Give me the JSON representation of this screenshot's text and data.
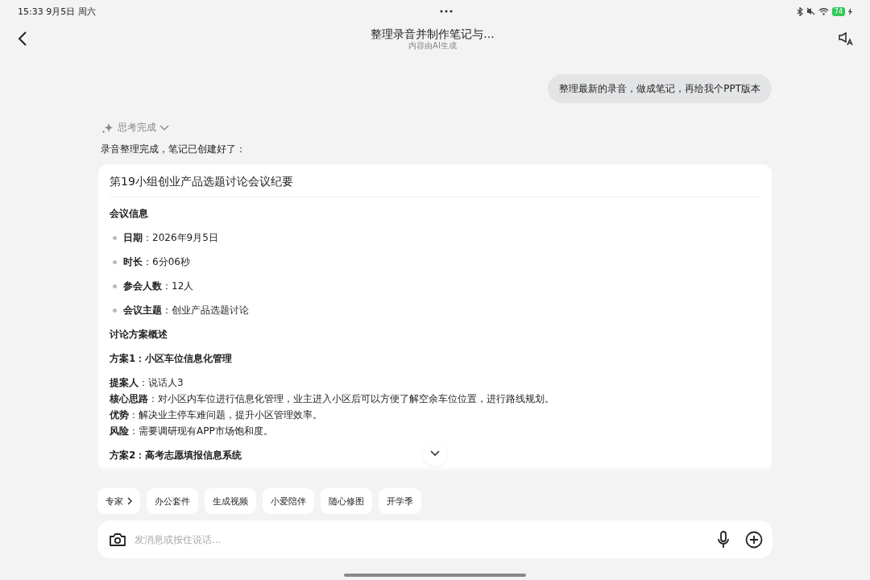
{
  "status_bar": {
    "time": "15:33  9月5日 周六",
    "battery": "74"
  },
  "header": {
    "title": "整理录音并制作笔记与...",
    "subtitle": "内容由AI生成"
  },
  "user_message": "整理最新的录音，做成笔记，再给我个PPT版本",
  "thinking": {
    "label": "思考完成",
    "expanded": false
  },
  "reply_intro": "录音整理完成，笔记已创建好了：",
  "note_card": {
    "title": "第19小组创业产品选题讨论会议纪要",
    "blocks": [
      {
        "kind": "heading",
        "text": "会议信息"
      },
      {
        "kind": "bullet",
        "text": "**日期**：2026年9月5日"
      },
      {
        "kind": "bullet",
        "text": "**时长**：6分06秒"
      },
      {
        "kind": "bullet",
        "text": "**参会人数**：12人"
      },
      {
        "kind": "bullet",
        "text": "**会议主题**：创业产品选题讨论"
      },
      {
        "kind": "heading",
        "text": "讨论方案概述"
      },
      {
        "kind": "subheading",
        "text": "方案1：小区车位信息化管理"
      },
      {
        "kind": "line",
        "text": "**提案人**：说话人3"
      },
      {
        "kind": "line",
        "text": "**核心思路**：对小区内车位进行信息化管理，业主进入小区后可以方便了解空余车位位置，进行路线规划。"
      },
      {
        "kind": "line",
        "text": "**优势**：解决业主停车难问题，提升小区管理效率。"
      },
      {
        "kind": "line",
        "text": "**风险**：需要调研现有APP市场饱和度。"
      },
      {
        "kind": "subheading",
        "text": "方案2：高考志愿填报信息系统"
      }
    ]
  },
  "chips": [
    {
      "label": "专家",
      "has_arrow": true
    },
    {
      "label": "办公套件",
      "has_arrow": false
    },
    {
      "label": "生成视频",
      "has_arrow": false
    },
    {
      "label": "小爱陪伴",
      "has_arrow": false
    },
    {
      "label": "随心修图",
      "has_arrow": false
    },
    {
      "label": "开学季",
      "has_arrow": false
    }
  ],
  "composer": {
    "placeholder": "发消息或按住说话..."
  }
}
